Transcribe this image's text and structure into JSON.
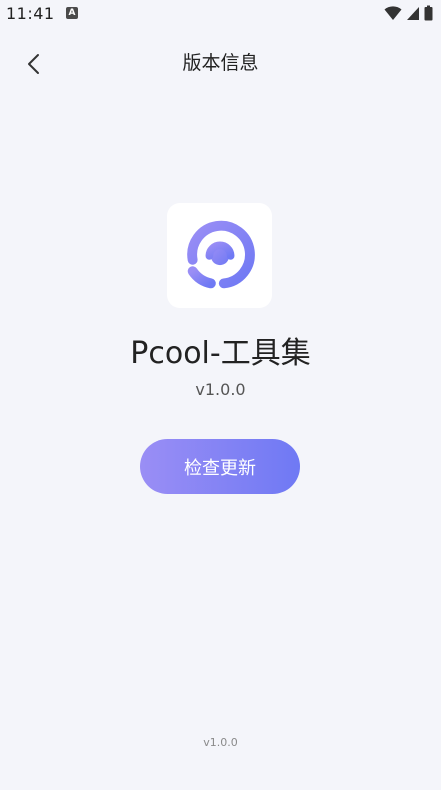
{
  "status_bar": {
    "time": "11:41",
    "notification_icon_letter": "A",
    "icons": [
      "wifi-icon",
      "signal-icon",
      "battery-icon"
    ]
  },
  "nav": {
    "title": "版本信息",
    "back_icon": "chevron-left-icon"
  },
  "app": {
    "name": "Pcool-工具集",
    "version": "v1.0.0",
    "logo_icon": "pcool-logo-icon"
  },
  "actions": {
    "check_update_label": "检查更新"
  },
  "footer": {
    "version": "v1.0.0"
  },
  "colors": {
    "background": "#f4f5fa",
    "accent_start": "#9a8ef5",
    "accent_end": "#6f79f4"
  }
}
